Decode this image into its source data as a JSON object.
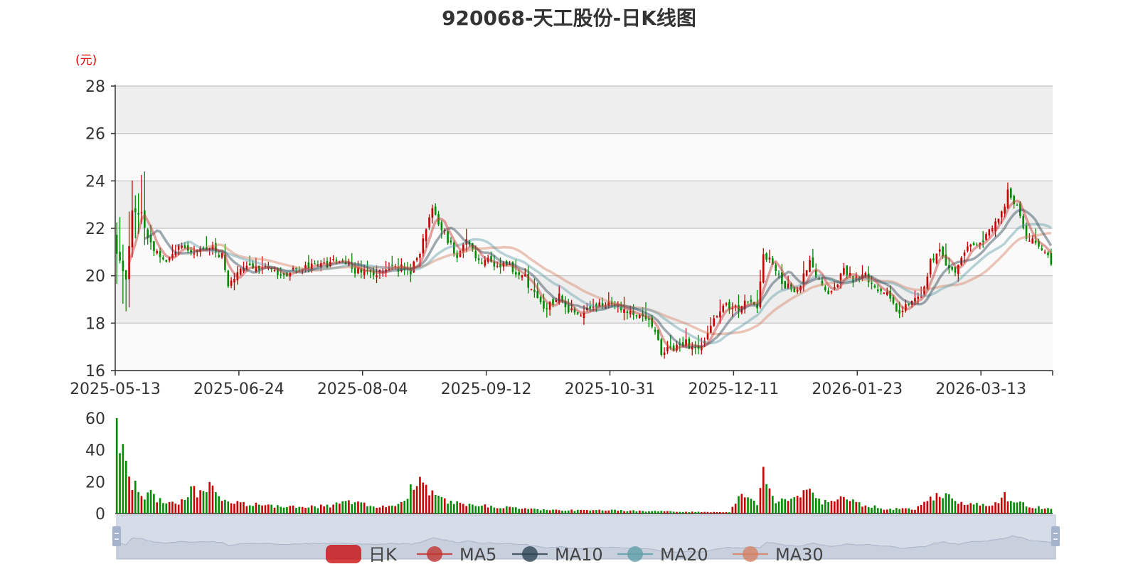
{
  "chart_data": {
    "type": "candlestick",
    "title": "920068-天工股份-日K线图",
    "y_unit": "(元)",
    "ylim": [
      16,
      28
    ],
    "y_ticks": [
      16,
      18,
      20,
      22,
      24,
      26,
      28
    ],
    "x_tick_labels": [
      "2025-05-13",
      "2025-06-24",
      "2025-08-04",
      "2025-09-12",
      "2025-10-31",
      "2025-12-11",
      "2026-01-23",
      "2026-03-13"
    ],
    "volume_ylim": [
      0,
      60
    ],
    "volume_ticks": [
      0,
      20,
      40,
      60
    ],
    "legend": [
      "日K",
      "MA5",
      "MA10",
      "MA20",
      "MA30"
    ],
    "colors": {
      "up": "#c80000",
      "down": "#008c00",
      "ma5": "#c23531",
      "ma10": "#2f4554",
      "ma20": "#61a0a8",
      "ma30": "#d48265"
    },
    "anchors": [
      {
        "i": 0,
        "c": 21.0
      },
      {
        "i": 3,
        "c": 19.8
      },
      {
        "i": 5,
        "c": 22.8
      },
      {
        "i": 8,
        "c": 22.5
      },
      {
        "i": 12,
        "c": 21.0
      },
      {
        "i": 15,
        "c": 20.6
      },
      {
        "i": 20,
        "c": 21.2
      },
      {
        "i": 25,
        "c": 21.0
      },
      {
        "i": 30,
        "c": 21.3
      },
      {
        "i": 34,
        "c": 20.8
      },
      {
        "i": 36,
        "c": 19.6
      },
      {
        "i": 38,
        "c": 19.9
      },
      {
        "i": 42,
        "c": 20.4
      },
      {
        "i": 50,
        "c": 20.2
      },
      {
        "i": 55,
        "c": 20.1
      },
      {
        "i": 60,
        "c": 20.3
      },
      {
        "i": 65,
        "c": 20.4
      },
      {
        "i": 72,
        "c": 20.6
      },
      {
        "i": 78,
        "c": 20.2
      },
      {
        "i": 82,
        "c": 20.0
      },
      {
        "i": 90,
        "c": 20.4
      },
      {
        "i": 95,
        "c": 20.2
      },
      {
        "i": 98,
        "c": 21.0
      },
      {
        "i": 100,
        "c": 22.0
      },
      {
        "i": 102,
        "c": 22.8
      },
      {
        "i": 104,
        "c": 22.3
      },
      {
        "i": 107,
        "c": 21.5
      },
      {
        "i": 110,
        "c": 20.9
      },
      {
        "i": 113,
        "c": 21.4
      },
      {
        "i": 116,
        "c": 20.8
      },
      {
        "i": 120,
        "c": 20.6
      },
      {
        "i": 124,
        "c": 20.5
      },
      {
        "i": 128,
        "c": 20.3
      },
      {
        "i": 132,
        "c": 19.9
      },
      {
        "i": 136,
        "c": 18.9
      },
      {
        "i": 139,
        "c": 18.7
      },
      {
        "i": 143,
        "c": 19.1
      },
      {
        "i": 146,
        "c": 18.6
      },
      {
        "i": 149,
        "c": 18.3
      },
      {
        "i": 153,
        "c": 18.6
      },
      {
        "i": 157,
        "c": 18.8
      },
      {
        "i": 162,
        "c": 18.7
      },
      {
        "i": 166,
        "c": 18.5
      },
      {
        "i": 170,
        "c": 18.4
      },
      {
        "i": 173,
        "c": 17.9
      },
      {
        "i": 176,
        "c": 16.8
      },
      {
        "i": 180,
        "c": 16.9
      },
      {
        "i": 184,
        "c": 17.2
      },
      {
        "i": 188,
        "c": 16.8
      },
      {
        "i": 192,
        "c": 17.9
      },
      {
        "i": 196,
        "c": 18.9
      },
      {
        "i": 200,
        "c": 18.6
      },
      {
        "i": 204,
        "c": 19.0
      },
      {
        "i": 207,
        "c": 18.6
      },
      {
        "i": 209,
        "c": 20.8
      },
      {
        "i": 212,
        "c": 20.6
      },
      {
        "i": 215,
        "c": 19.6
      },
      {
        "i": 220,
        "c": 19.4
      },
      {
        "i": 224,
        "c": 20.6
      },
      {
        "i": 227,
        "c": 19.8
      },
      {
        "i": 231,
        "c": 19.2
      },
      {
        "i": 235,
        "c": 20.3
      },
      {
        "i": 238,
        "c": 19.9
      },
      {
        "i": 242,
        "c": 20.0
      },
      {
        "i": 245,
        "c": 19.6
      },
      {
        "i": 249,
        "c": 19.2
      },
      {
        "i": 252,
        "c": 18.5
      },
      {
        "i": 256,
        "c": 18.8
      },
      {
        "i": 260,
        "c": 19.0
      },
      {
        "i": 263,
        "c": 20.6
      },
      {
        "i": 266,
        "c": 21.2
      },
      {
        "i": 268,
        "c": 20.6
      },
      {
        "i": 271,
        "c": 20.0
      },
      {
        "i": 274,
        "c": 21.0
      },
      {
        "i": 277,
        "c": 21.2
      },
      {
        "i": 280,
        "c": 21.5
      },
      {
        "i": 283,
        "c": 22.0
      },
      {
        "i": 286,
        "c": 22.6
      },
      {
        "i": 288,
        "c": 23.5
      },
      {
        "i": 291,
        "c": 23.0
      },
      {
        "i": 294,
        "c": 21.6
      },
      {
        "i": 297,
        "c": 21.4
      },
      {
        "i": 300,
        "c": 20.9
      },
      {
        "i": 302,
        "c": 20.6
      }
    ],
    "volume_anchors": [
      {
        "i": 0,
        "v": 50
      },
      {
        "i": 1,
        "v": 33
      },
      {
        "i": 2,
        "v": 47
      },
      {
        "i": 3,
        "v": 34
      },
      {
        "i": 4,
        "v": 23
      },
      {
        "i": 5,
        "v": 18
      },
      {
        "i": 6,
        "v": 21
      },
      {
        "i": 7,
        "v": 13
      },
      {
        "i": 9,
        "v": 10
      },
      {
        "i": 11,
        "v": 15
      },
      {
        "i": 13,
        "v": 9
      },
      {
        "i": 16,
        "v": 6
      },
      {
        "i": 22,
        "v": 8
      },
      {
        "i": 24,
        "v": 16
      },
      {
        "i": 26,
        "v": 12
      },
      {
        "i": 30,
        "v": 18
      },
      {
        "i": 33,
        "v": 9
      },
      {
        "i": 40,
        "v": 6
      },
      {
        "i": 50,
        "v": 5
      },
      {
        "i": 60,
        "v": 4
      },
      {
        "i": 70,
        "v": 5
      },
      {
        "i": 75,
        "v": 8
      },
      {
        "i": 85,
        "v": 4
      },
      {
        "i": 92,
        "v": 6
      },
      {
        "i": 96,
        "v": 18
      },
      {
        "i": 98,
        "v": 21
      },
      {
        "i": 101,
        "v": 14
      },
      {
        "i": 104,
        "v": 10
      },
      {
        "i": 108,
        "v": 7
      },
      {
        "i": 115,
        "v": 5
      },
      {
        "i": 125,
        "v": 4
      },
      {
        "i": 140,
        "v": 2
      },
      {
        "i": 160,
        "v": 2
      },
      {
        "i": 185,
        "v": 1
      },
      {
        "i": 198,
        "v": 1
      },
      {
        "i": 200,
        "v": 8
      },
      {
        "i": 202,
        "v": 12
      },
      {
        "i": 205,
        "v": 9
      },
      {
        "i": 207,
        "v": 7
      },
      {
        "i": 209,
        "v": 24
      },
      {
        "i": 210,
        "v": 20
      },
      {
        "i": 213,
        "v": 8
      },
      {
        "i": 218,
        "v": 9
      },
      {
        "i": 223,
        "v": 14
      },
      {
        "i": 228,
        "v": 7
      },
      {
        "i": 234,
        "v": 10
      },
      {
        "i": 240,
        "v": 6
      },
      {
        "i": 248,
        "v": 3
      },
      {
        "i": 258,
        "v": 3
      },
      {
        "i": 264,
        "v": 10
      },
      {
        "i": 268,
        "v": 12
      },
      {
        "i": 274,
        "v": 6
      },
      {
        "i": 282,
        "v": 5
      },
      {
        "i": 287,
        "v": 11
      },
      {
        "i": 289,
        "v": 9
      },
      {
        "i": 294,
        "v": 5
      },
      {
        "i": 302,
        "v": 3
      }
    ],
    "n": 303
  }
}
